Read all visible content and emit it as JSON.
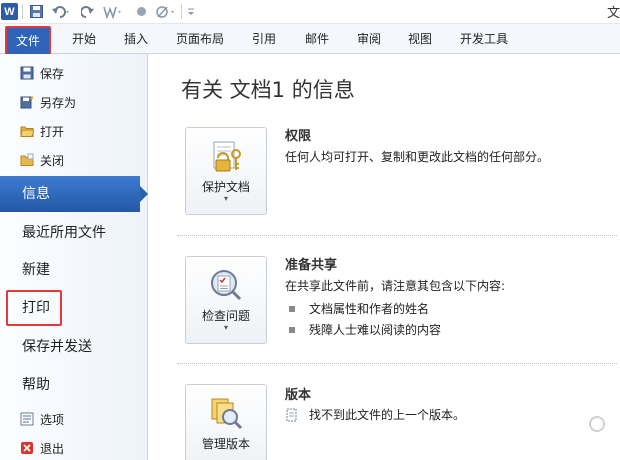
{
  "window": {
    "title": "文"
  },
  "quick_access": {
    "icons": [
      "word-logo",
      "save-icon",
      "undo-icon",
      "redo-icon",
      "format-painter-icon",
      "record-icon",
      "clear-format-icon",
      "customize-icon"
    ],
    "logo_letter": "W"
  },
  "ribbon": {
    "file_tab": "文件",
    "tabs": [
      "开始",
      "插入",
      "页面布局",
      "引用",
      "邮件",
      "审阅",
      "视图",
      "开发工具"
    ]
  },
  "sidebar": {
    "small_items": [
      {
        "label": "保存",
        "icon": "save-icon"
      },
      {
        "label": "另存为",
        "icon": "save-as-icon"
      },
      {
        "label": "打开",
        "icon": "open-folder-icon"
      },
      {
        "label": "关闭",
        "icon": "close-folder-icon"
      }
    ],
    "active": "信息",
    "big_items": [
      "最近所用文件",
      "新建",
      "打印",
      "保存并发送",
      "帮助"
    ],
    "bottom_items": [
      {
        "label": "选项",
        "icon": "options-icon"
      },
      {
        "label": "退出",
        "icon": "exit-icon"
      }
    ]
  },
  "main": {
    "title": "有关 文档1 的信息",
    "sections": [
      {
        "button_label": "保护文档",
        "heading": "权限",
        "text": "任何人均可打开、复制和更改此文档的任何部分。"
      },
      {
        "button_label": "检查问题",
        "heading": "准备共享",
        "text": "在共享此文件前，请注意其包含以下内容:",
        "bullets": [
          "文档属性和作者的姓名",
          "残障人士难以阅读的内容"
        ]
      },
      {
        "button_label": "管理版本",
        "heading": "版本",
        "text": "找不到此文件的上一个版本。"
      }
    ]
  },
  "colors": {
    "accent": "#2e63b8",
    "highlight": "#e23a3a"
  }
}
